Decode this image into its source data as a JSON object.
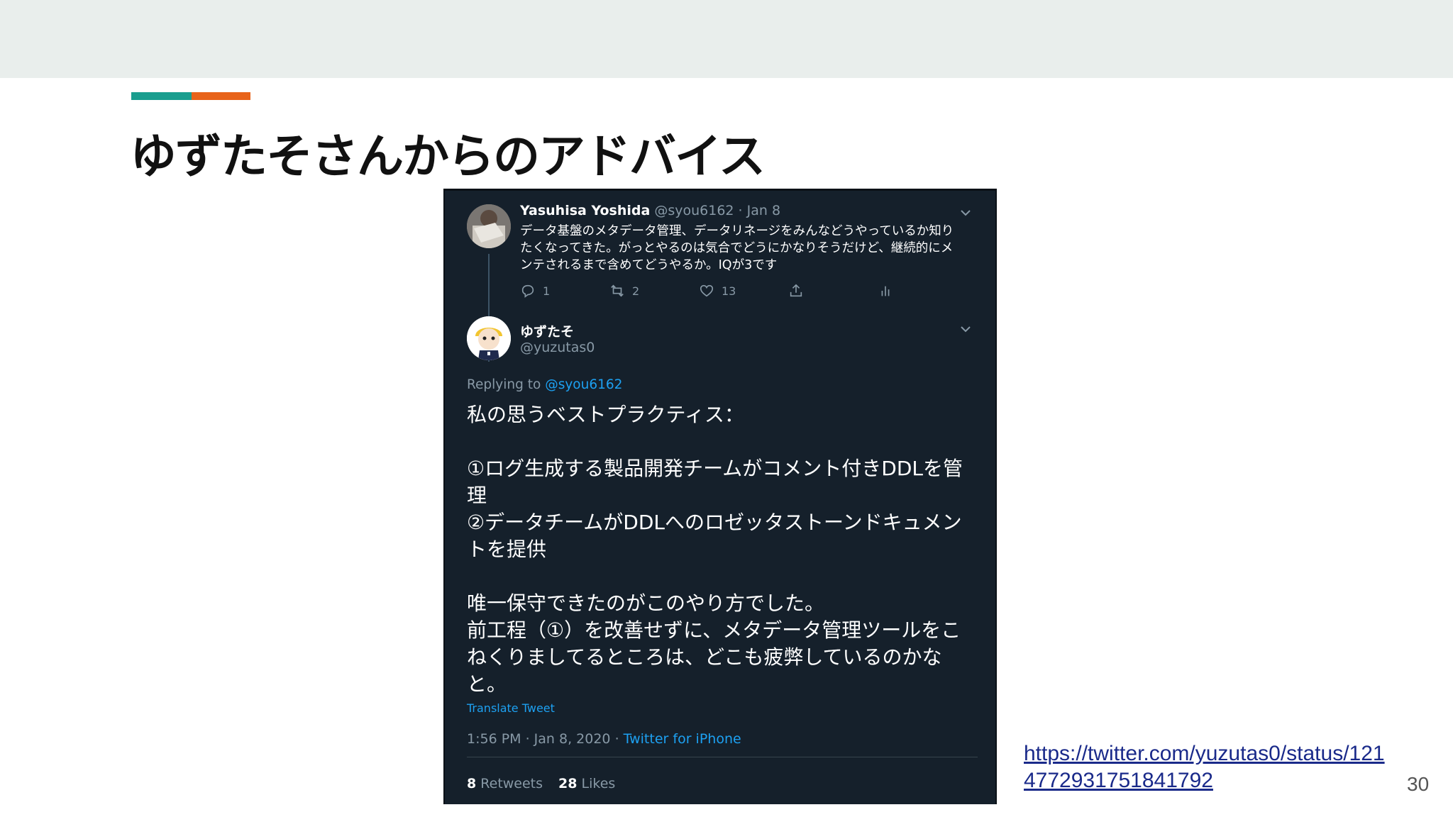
{
  "colors": {
    "header_band": "#e9eeec",
    "accent_teal": "#1a9e8f",
    "accent_orange": "#e8631a",
    "tweet_bg": "#15202b",
    "tweet_link_blue": "#1da1f2",
    "slide_link": "#1a2a8a"
  },
  "slide": {
    "title": "ゆずたそさんからのアドバイス",
    "link": "https://twitter.com/yuzutas0/status/1214772931751841792",
    "page_number": "30"
  },
  "tweet_parent": {
    "name": "Yasuhisa Yoshida",
    "meta": "@syou6162 · Jan 8",
    "text": "データ基盤のメタデータ管理、データリネージをみんなどうやっているか知りたくなってきた。がっとやるのは気合でどうにかなりそうだけど、継続的にメンテされるまで含めてどうやるか。IQが3です",
    "reply_count": "1",
    "retweet_count": "2",
    "like_count": "13",
    "icons": [
      "reply-icon",
      "retweet-icon",
      "like-icon",
      "share-icon",
      "analytics-icon",
      "chevron-down-icon"
    ]
  },
  "tweet_main": {
    "name": "ゆずたそ",
    "handle": "@yuzutas0",
    "replying_to_label": "Replying to",
    "replying_to_handle": "@syou6162",
    "body": "私の思うベストプラクティス：\n\n①ログ生成する製品開発チームがコメント付きDDLを管理\n②データチームがDDLへのロゼッタストーンドキュメントを提供\n\n唯一保守できたのがこのやり方でした。\n前工程（①）を改善せずに、メタデータ管理ツールをこねくりましてるところは、どこも疲弊しているのかなと。",
    "translate_label": "Translate Tweet",
    "timestamp": "1:56 PM · Jan 8, 2020 ·",
    "source": "Twitter for iPhone",
    "retweets_count": "8",
    "retweets_label": "Retweets",
    "likes_count": "28",
    "likes_label": "Likes"
  }
}
